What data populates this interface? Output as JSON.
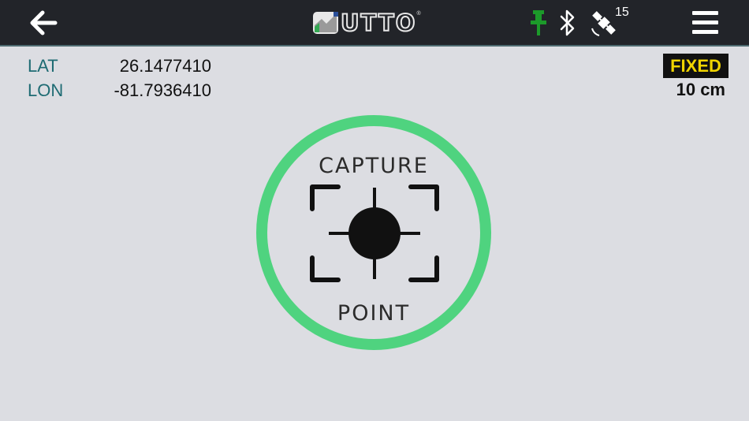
{
  "app": {
    "logo_text": "UTTO",
    "logo_mark": "®"
  },
  "toolbar": {
    "back_icon": "arrow-left-icon",
    "pin_icon": "pin-icon",
    "bluetooth_icon": "bluetooth-icon",
    "satellite_icon": "satellite-icon",
    "satellite_count": "15",
    "menu_icon": "hamburger-menu-icon"
  },
  "position": {
    "lat_label": "LAT",
    "lat_value": "26.1477410",
    "lon_label": "LON",
    "lon_value": "-81.7936410"
  },
  "status": {
    "fix_label": "FIXED",
    "accuracy": "10 cm"
  },
  "capture": {
    "top_label": "CAPTURE",
    "bottom_label": "POINT"
  },
  "colors": {
    "topbar": "#222429",
    "background": "#dcdde2",
    "accent_green": "#4fd37f",
    "pin_green": "#1c9a2a",
    "coord_label": "#1e6b73",
    "fixed_text": "#f0d400"
  }
}
